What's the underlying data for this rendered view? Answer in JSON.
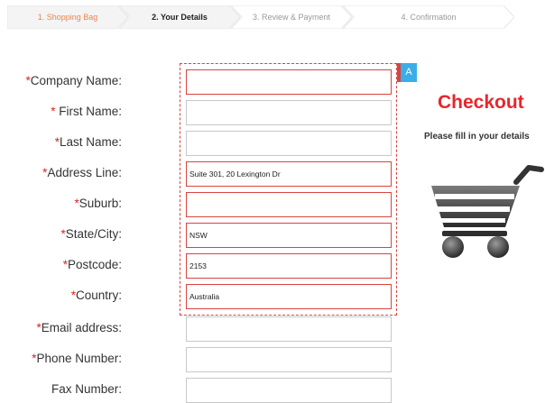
{
  "steps": [
    {
      "label": "1. Shopping Bag"
    },
    {
      "label": "2. Your Details"
    },
    {
      "label": "3. Review & Payment"
    },
    {
      "label": "4. Confirmation"
    }
  ],
  "form": {
    "required_mark": "*",
    "fields": [
      {
        "label": "Company Name:",
        "value": "",
        "required": true
      },
      {
        "label": "First Name:",
        "value": "",
        "required": true
      },
      {
        "label": "Last Name:",
        "value": "",
        "required": true
      },
      {
        "label": "Address Line:",
        "value": "Suite 301, 20 Lexington Dr",
        "required": true
      },
      {
        "label": "Suburb:",
        "value": "",
        "required": true
      },
      {
        "label": "State/City:",
        "value": "NSW",
        "required": true
      },
      {
        "label": "Postcode:",
        "value": "2153",
        "required": true
      },
      {
        "label": "Country:",
        "value": "Australia",
        "required": true
      },
      {
        "label": "Email address:",
        "value": "",
        "required": true
      },
      {
        "label": "Phone Number:",
        "value": "",
        "required": true
      },
      {
        "label": "Fax Number:",
        "value": "",
        "required": false
      }
    ]
  },
  "selection": {
    "tag": "A"
  },
  "panel": {
    "title": "Checkout",
    "subtitle": "Please fill in your details"
  },
  "colors": {
    "accent_red": "#e8262b",
    "error_border": "#d9443f",
    "step_active_orange": "#e8874a",
    "tag_blue": "#3aaee8"
  },
  "icons": {
    "cart": "shopping-cart-icon"
  }
}
